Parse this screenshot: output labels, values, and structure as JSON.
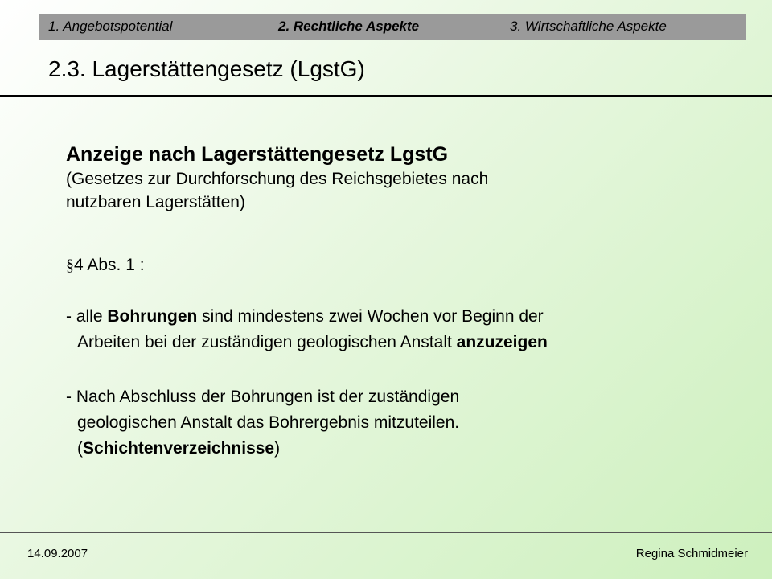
{
  "nav": {
    "tabs": [
      {
        "label": "1. Angebotspotential",
        "active": false
      },
      {
        "label": "2. Rechtliche Aspekte",
        "active": true
      },
      {
        "label": "3. Wirtschaftliche Aspekte",
        "active": false
      }
    ]
  },
  "slide": {
    "title": "2.3. Lagerstättengesetz  (LgstG)",
    "heading": "Anzeige nach Lagerstättengesetz LgstG",
    "subline_1": "(Gesetzes zur Durchforschung des Reichsgebietes nach",
    "subline_2": "nutzbaren Lagerstätten)",
    "paragraph_symbol": "§",
    "paragraph_ref": "4 Abs. 1 :",
    "bullet_1": {
      "prefix": "- alle ",
      "bold_1": "Bohrungen",
      "middle": " sind mindestens zwei Wochen vor Beginn der",
      "line_2": "Arbeiten bei der zuständigen geologischen Anstalt ",
      "bold_2": "anzuzeigen"
    },
    "bullet_2": {
      "line_1": "- Nach Abschluss der Bohrungen ist der zuständigen",
      "line_2": "geologischen Anstalt das Bohrergebnis mitzuteilen.",
      "open": "(",
      "bold": "Schichtenverzeichnisse",
      "close": ")"
    }
  },
  "footer": {
    "date": "14.09.2007",
    "author": "Regina Schmidmeier"
  }
}
